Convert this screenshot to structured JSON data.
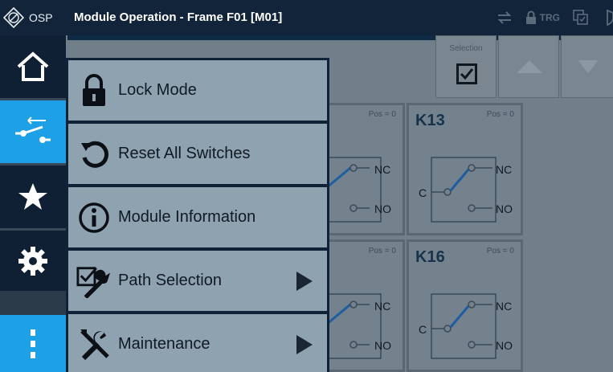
{
  "titlebar": {
    "app_name": "OSP",
    "title": "Module Operation - Frame F01 [M01]",
    "trg_label": "TRG"
  },
  "sidebar": {
    "items": [
      {
        "name": "home",
        "icon": "home-icon"
      },
      {
        "name": "switches",
        "icon": "switch-icon",
        "active": true
      },
      {
        "name": "favorites",
        "icon": "star-icon"
      },
      {
        "name": "settings",
        "icon": "gear-icon"
      },
      {
        "name": "more",
        "icon": "more-vertical-icon"
      }
    ]
  },
  "toolbar": {
    "selection_label": "Selection"
  },
  "cards": [
    {
      "name": "",
      "pos": "Pos = 0",
      "nc": "NC",
      "no": "NO",
      "c": ""
    },
    {
      "name": "K13",
      "pos": "Pos = 0",
      "nc": "NC",
      "no": "NO",
      "c": "C"
    },
    {
      "name": "",
      "pos": "Pos = 0",
      "nc": "NC",
      "no": "NO",
      "c": ""
    },
    {
      "name": "K16",
      "pos": "Pos = 0",
      "nc": "NC",
      "no": "NO",
      "c": "C"
    }
  ],
  "menu": {
    "items": [
      {
        "label": "Lock Mode",
        "icon": "lock-icon",
        "submenu": false
      },
      {
        "label": "Reset All Switches",
        "icon": "reset-icon",
        "submenu": false
      },
      {
        "label": "Module Information",
        "icon": "info-icon",
        "submenu": false
      },
      {
        "label": "Path Selection",
        "icon": "path-selection-icon",
        "submenu": true
      },
      {
        "label": "Maintenance",
        "icon": "tools-icon",
        "submenu": true
      }
    ]
  },
  "colors": {
    "titlebar_bg": "#12243a",
    "sidebar_bg": "#0f2035",
    "accent_blue": "#1ea0e6",
    "menu_item_bg": "#8fa2b0",
    "background": "#717f8a"
  }
}
